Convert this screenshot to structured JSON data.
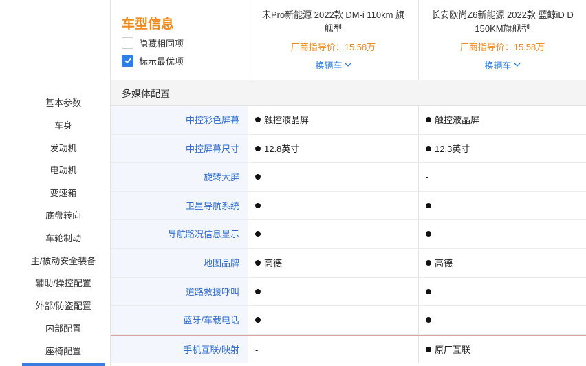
{
  "nav": {
    "items": [
      "基本参数",
      "车身",
      "发动机",
      "电动机",
      "变速箱",
      "底盘转向",
      "车轮制动",
      "主/被动安全装备",
      "辅助/操控配置",
      "外部/防盗配置",
      "内部配置",
      "座椅配置"
    ]
  },
  "header": {
    "title": "车型信息",
    "hide_same_label": "隐藏相同项",
    "hide_same_checked": false,
    "show_best_label": "标示最优项",
    "show_best_checked": true
  },
  "cars": [
    {
      "name": "宋Pro新能源 2022款 DM-i 110km 旗舰型",
      "price": "厂商指导价：15.58万",
      "swap_label": "换辆车"
    },
    {
      "name": "长安欧尚Z6新能源 2022款 蓝鲸iD D 150KM旗舰型",
      "price": "厂商指导价：15.58万",
      "swap_label": "换辆车"
    }
  ],
  "section_title": "多媒体配置",
  "rows": [
    {
      "label": "中控彩色屏幕",
      "v1": "触控液晶屏",
      "v1_dot": true,
      "v2": "触控液晶屏",
      "v2_dot": true
    },
    {
      "label": "中控屏幕尺寸",
      "v1": "12.8英寸",
      "v1_dot": true,
      "v2": "12.3英寸",
      "v2_dot": true
    },
    {
      "label": "旋转大屏",
      "v1": "",
      "v1_dot": true,
      "v2": "-",
      "v2_dot": false
    },
    {
      "label": "卫星导航系统",
      "v1": "",
      "v1_dot": true,
      "v2": "",
      "v2_dot": true
    },
    {
      "label": "导航路况信息显示",
      "v1": "",
      "v1_dot": true,
      "v2": "",
      "v2_dot": true
    },
    {
      "label": "地图品牌",
      "v1": "高德",
      "v1_dot": true,
      "v2": "高德",
      "v2_dot": true
    },
    {
      "label": "道路救援呼叫",
      "v1": "",
      "v1_dot": true,
      "v2": "",
      "v2_dot": true
    },
    {
      "label": "蓝牙/车载电话",
      "v1": "",
      "v1_dot": true,
      "v2": "",
      "v2_dot": true
    },
    {
      "label": "手机互联/映射",
      "v1": "-",
      "v1_dot": false,
      "v2": "原厂互联",
      "v2_dot": true
    }
  ],
  "colors": {
    "accent": "#f08a1c",
    "link": "#2f7ee6",
    "label_bg": "#f3f7fd"
  }
}
